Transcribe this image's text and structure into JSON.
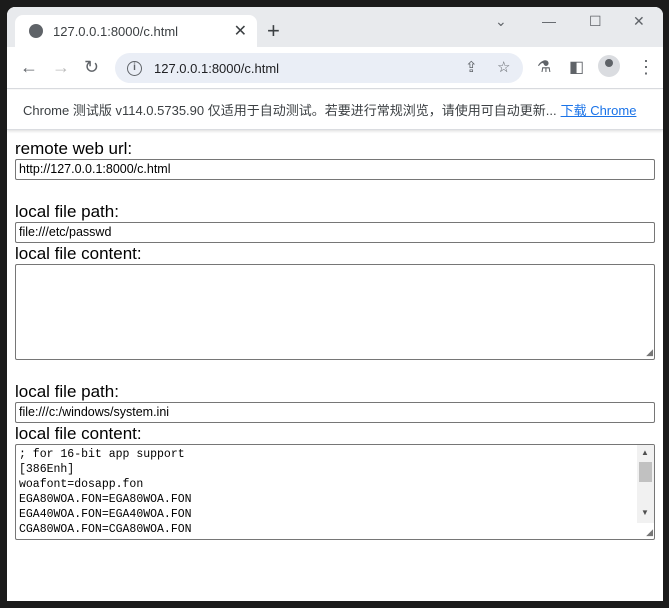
{
  "browser": {
    "tab_title": "127.0.0.1:8000/c.html",
    "url": "127.0.0.1:8000/c.html",
    "infobar_text": "Chrome 测试版 v114.0.5735.90 仅适用于自动测试。若要进行常规浏览，请使用可自动更新...",
    "infobar_link": "下载 Chrome"
  },
  "page": {
    "remote_label": "remote web url:",
    "remote_value": "http://127.0.0.1:8000/c.html",
    "section1": {
      "path_label": "local file path:",
      "path_value": "file:///etc/passwd",
      "content_label": "local file content:",
      "content": ""
    },
    "section2": {
      "path_label": "local file path:",
      "path_value": "file:///c:/windows/system.ini",
      "content_label": "local file content:",
      "content": "; for 16-bit app support\n[386Enh]\nwoafont=dosapp.fon\nEGA80WOA.FON=EGA80WOA.FON\nEGA40WOA.FON=EGA40WOA.FON\nCGA80WOA.FON=CGA80WOA.FON"
    }
  }
}
